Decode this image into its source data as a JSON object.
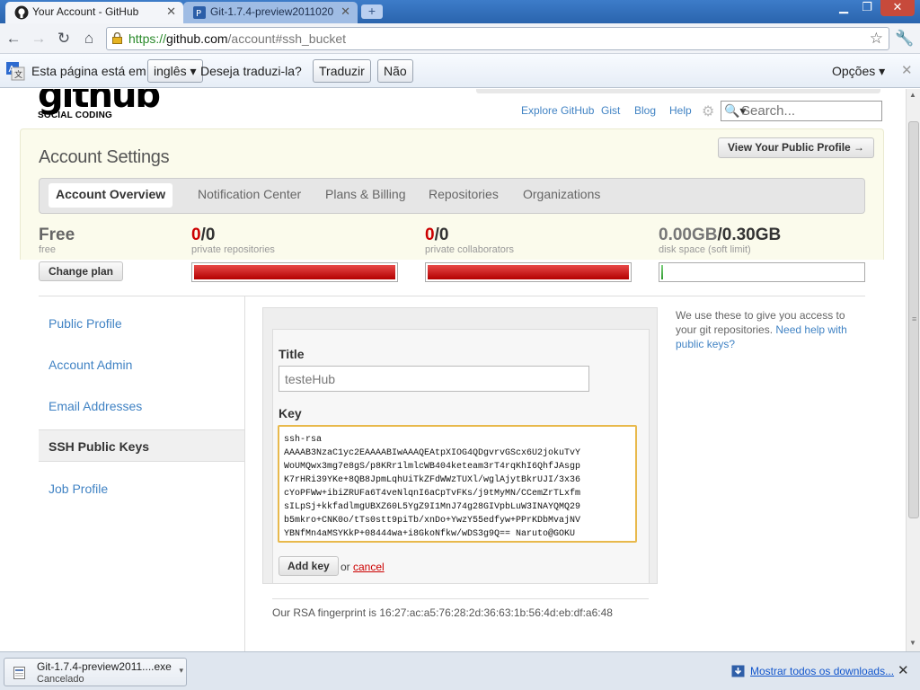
{
  "browser": {
    "tabs": [
      {
        "title": "Your Account - GitHub",
        "active": true
      },
      {
        "title": "Git-1.7.4-preview2011020...",
        "active": false
      }
    ],
    "url": {
      "scheme": "https://",
      "host": "github.com",
      "path": "/account#ssh_bucket"
    }
  },
  "translate_bar": {
    "text1": "Esta página está em",
    "language": "inglês",
    "text2": "Deseja traduzi-la?",
    "translate_button": "Traduzir",
    "no_button": "Não",
    "options": "Opções"
  },
  "header": {
    "logo_main": "github",
    "logo_sub": "SOCIAL CODING",
    "links": [
      "Explore GitHub",
      "Gist",
      "Blog",
      "Help"
    ],
    "search_placeholder": "Search..."
  },
  "settings": {
    "title": "Account Settings",
    "public_profile_button": "View Your Public Profile →",
    "tabs": [
      "Account Overview",
      "Notification Center",
      "Plans & Billing",
      "Repositories",
      "Organizations"
    ]
  },
  "stats": {
    "plan": {
      "value": "Free",
      "label": "free",
      "button": "Change plan"
    },
    "repos": {
      "used": "0",
      "total": "/0",
      "label": "private repositories",
      "fill_fraction": 1.0
    },
    "collaborators": {
      "used": "0",
      "total": "/0",
      "label": "private collaborators",
      "fill_fraction": 1.0
    },
    "disk": {
      "used": "0.00GB",
      "total": "/0.30GB",
      "label": "disk space (soft limit)",
      "fill_fraction": 0.0
    }
  },
  "sidebar": {
    "items": [
      "Public Profile",
      "Account Admin",
      "Email Addresses",
      "SSH Public Keys",
      "Job Profile"
    ],
    "active": "SSH Public Keys"
  },
  "ssh_form": {
    "title_label": "Title",
    "title_value": "testeHub",
    "key_label": "Key",
    "key_value": "ssh-rsa\nAAAAB3NzaC1yc2EAAAABIwAAAQEAtpXIOG4QDgvrvGScx6U2jokuTvY\nWoUMQwx3mg7e8gS/p8KRr1lmlcWB404keteam3rT4rqKhI6QhfJAsgp\nK7rHRi39YKe+8QB8JpmLqhUiTkZFdWWzTUXl/wglAjytBkrUJI/3x36\ncYoPFWw+ibiZRUFa6T4veNlqnI6aCpTvFKs/j9tMyMN/CCemZrTLxfm\nsILpSj+kkfadlmgUBXZ60L5YgZ9I1MnJ74g28GIVpbLuW3INAYQMQ29\nb5mkro+CNK0o/tTs0stt9piTb/xnDo+YwzY55edfyw+PPrKDbMvajNV\nYBNfMn4aMSYKkP+08444wa+i8GkoNfkw/wDS3g9Q== Naruto@GOKU",
    "add_button": "Add key",
    "or_text": "or",
    "cancel_link": "cancel",
    "fingerprint": "Our RSA fingerprint is 16:27:ac:a5:76:28:2d:36:63:1b:56:4d:eb:df:a6:48"
  },
  "help": {
    "text": "We use these to give you access to your git repositories. ",
    "link": "Need help with public keys?"
  },
  "downloads": {
    "file": "Git-1.7.4-preview2011....exe",
    "status": "Cancelado",
    "show_all": "Mostrar todos os downloads..."
  }
}
